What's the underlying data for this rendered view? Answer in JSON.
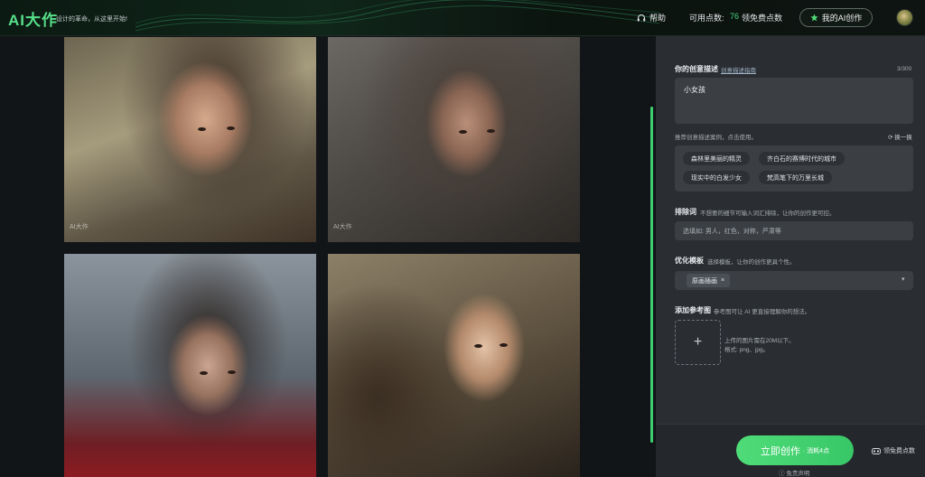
{
  "header": {
    "logo": "AI大作",
    "slogan": "设计的革命，从这里开始!",
    "help": "帮助",
    "points_label": "可用点数:",
    "points_value": "76",
    "free_points": "领免费点数",
    "my_works": "我的AI创作"
  },
  "gallery": {
    "watermark": "AI大作"
  },
  "panel": {
    "desc_label": "你的创意描述",
    "desc_guide_link": "创意描述指南",
    "desc_counter": "3/300",
    "desc_value": "小女孩",
    "suggest_hint": "推荐创意描述案例，点击使用。",
    "refresh": "换一换",
    "suggestions": [
      "森林里美丽的精灵",
      "齐白石的赛博时代的城市",
      "现实中的白发少女",
      "梵高笔下的万里长城"
    ],
    "exclude_label": "排除词",
    "exclude_hint": "不想要的细节可输入词汇排除，让你的创作更可控。",
    "exclude_placeholder": "选填如: 男人，红色，对称，严肃等",
    "template_label": "优化模板",
    "template_hint": "选择模板，让你的创作更具个性。",
    "template_tag": "原画插画",
    "ref_label": "添加参考图",
    "ref_hint": "参考图可让 AI 更直接理解你的想法。",
    "upload_plus": "+",
    "upload_note1": "上传的图片需在20M以下。",
    "upload_note2": "格式: png、jpg。"
  },
  "footer": {
    "create_label": "立即创作",
    "create_cost": "· 消耗4点",
    "free_points": "领免费点数",
    "disclaimer": "免责声明"
  },
  "colors": {
    "accent": "#3bd06f",
    "panel_bg": "#2a2d31",
    "field_bg": "#3b3f44"
  }
}
